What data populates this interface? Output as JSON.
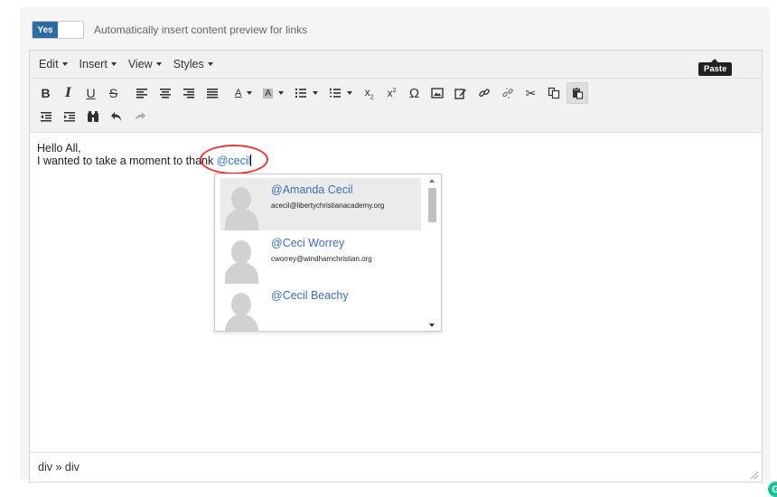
{
  "toggle": {
    "on_label": "Yes",
    "description": "Automatically insert content preview for links"
  },
  "menubar": {
    "items": [
      "Edit",
      "Insert",
      "View",
      "Styles"
    ]
  },
  "tooltip": {
    "text": "Paste"
  },
  "content": {
    "line1": "Hello All,",
    "line2_prefix": "I wanted to take a moment to thank ",
    "mention_query": "@cecil"
  },
  "mention_dropdown": {
    "items": [
      {
        "name": "@Amanda Cecil",
        "email": "acecil@libertychristianacademy.org",
        "selected": true
      },
      {
        "name": "@Ceci Worrey",
        "email": "cworrey@windhamchristian.org",
        "selected": false
      },
      {
        "name": "@Cecil Beachy",
        "email": "",
        "selected": false
      }
    ]
  },
  "statusbar": {
    "path": "div » div"
  },
  "colors": {
    "accent": "#2d6ca2",
    "mention_link": "#3c6fb4",
    "annotation": "#e53a3a",
    "grammarly": "#15c39a"
  },
  "icons": [
    "bold",
    "italic",
    "underline",
    "strikethrough",
    "align-left",
    "align-center",
    "align-right",
    "align-justify",
    "text-color",
    "background-color",
    "bullet-list",
    "numbered-list",
    "subscript",
    "superscript",
    "special-character",
    "image",
    "edit",
    "link",
    "unlink",
    "cut",
    "copy",
    "paste",
    "outdent",
    "indent",
    "find",
    "undo",
    "redo"
  ]
}
